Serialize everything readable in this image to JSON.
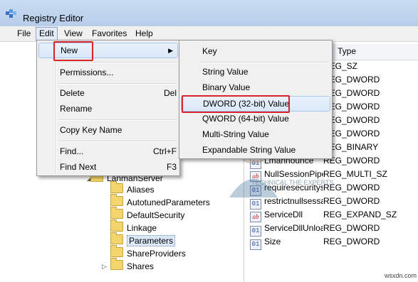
{
  "window": {
    "title": "Registry Editor"
  },
  "menubar": {
    "items": [
      "File",
      "Edit",
      "View",
      "Favorites",
      "Help"
    ]
  },
  "edit_menu": {
    "items": [
      {
        "label": "New",
        "shortcut": "",
        "submenu": true
      },
      {
        "label": "Permissions...",
        "shortcut": ""
      },
      {
        "label": "Delete",
        "shortcut": "Del"
      },
      {
        "label": "Rename",
        "shortcut": ""
      },
      {
        "label": "Copy Key Name",
        "shortcut": ""
      },
      {
        "label": "Find...",
        "shortcut": "Ctrl+F"
      },
      {
        "label": "Find Next",
        "shortcut": "F3"
      }
    ]
  },
  "new_submenu": {
    "items": [
      "Key",
      "String Value",
      "Binary Value",
      "DWORD (32-bit) Value",
      "QWORD (64-bit) Value",
      "Multi-String Value",
      "Expandable String Value"
    ],
    "highlighted": "DWORD (32-bit) Value"
  },
  "tree": {
    "parent": "LanmanServer",
    "children": [
      "Aliases",
      "AutotunedParameters",
      "DefaultSecurity",
      "Linkage",
      "Parameters",
      "ShareProviders",
      "Shares"
    ],
    "selected": "Parameters"
  },
  "values_pane": {
    "type_header": "Type",
    "rows": [
      {
        "name": "",
        "type": "REG_SZ"
      },
      {
        "name": "",
        "type": "REG_DWORD"
      },
      {
        "name": "",
        "type": "REG_DWORD"
      },
      {
        "name": "",
        "type": "REG_DWORD"
      },
      {
        "name": "",
        "type": "REG_DWORD"
      },
      {
        "name": "",
        "type": "REG_DWORD"
      },
      {
        "name": "",
        "type": "REG_BINARY"
      },
      {
        "name": "Lmannounce",
        "type": "REG_DWORD",
        "icon": "binary"
      },
      {
        "name": "NullSessionPipes",
        "type": "REG_MULTI_SZ",
        "icon": "string"
      },
      {
        "name": "requiresecuritysi...",
        "type": "REG_DWORD",
        "icon": "binary"
      },
      {
        "name": "restrictnullsessa...",
        "type": "REG_DWORD",
        "icon": "binary"
      },
      {
        "name": "ServiceDll",
        "type": "REG_EXPAND_SZ",
        "icon": "string"
      },
      {
        "name": "ServiceDllUnloa...",
        "type": "REG_DWORD",
        "icon": "binary"
      },
      {
        "name": "Size",
        "type": "REG_DWORD",
        "icon": "binary"
      }
    ]
  },
  "icons": {
    "binary_glyph": "01",
    "string_glyph": "ab"
  },
  "colors": {
    "callout": "#d6242a",
    "highlight": "#d9e8f9"
  },
  "watermark": {
    "text": "TECHNICAL THE EXPERTS"
  },
  "site_mark": "wsxdn.com"
}
